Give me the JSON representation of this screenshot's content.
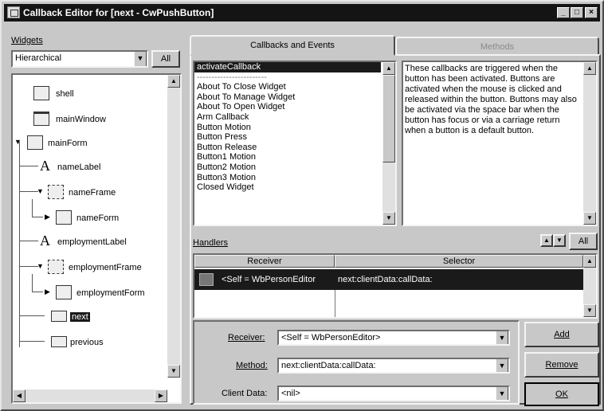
{
  "window": {
    "title": "Callback Editor for [next - CwPushButton]",
    "buttons": [
      "_",
      "□",
      "×"
    ]
  },
  "widgets_panel": {
    "label": "Widgets",
    "view_mode": "Hierarchical",
    "all_button": "All",
    "tree": [
      {
        "name": "shell",
        "icon": "shell-icon"
      },
      {
        "name": "mainWindow",
        "icon": "window-icon"
      },
      {
        "name": "mainForm",
        "icon": "form-icon"
      },
      {
        "name": "nameLabel",
        "icon": "label-icon"
      },
      {
        "name": "nameFrame",
        "icon": "frame-icon"
      },
      {
        "name": "nameForm",
        "icon": "form-icon"
      },
      {
        "name": "employmentLabel",
        "icon": "label-icon"
      },
      {
        "name": "employmentFrame",
        "icon": "frame-icon"
      },
      {
        "name": "employmentForm",
        "icon": "form-icon"
      },
      {
        "name": "next",
        "icon": "button-icon"
      },
      {
        "name": "previous",
        "icon": "button-icon"
      }
    ]
  },
  "tabs": [
    {
      "label": "Callbacks and Events",
      "active": true
    },
    {
      "label": "Methods",
      "active": false
    }
  ],
  "callbacks": {
    "selected": "activateCallback",
    "separator": "------------------------",
    "items": [
      "About To Close Widget",
      "About To Manage Widget",
      "About To Open Widget",
      "Arm Callback",
      "Button Motion",
      "Button Press",
      "Button Release",
      "Button1 Motion",
      "Button2 Motion",
      "Button3 Motion",
      "Closed Widget"
    ]
  },
  "description": "These callbacks are triggered when the button has been activated. Buttons are activated when the mouse is clicked and released within the button. Buttons may also be activated via the space bar when the button has focus or via a carriage return when a button is a default button.",
  "handlers": {
    "label": "Handlers",
    "all_button": "All",
    "columns": [
      "Receiver",
      "Selector"
    ],
    "rows": [
      {
        "receiver": "<Self = WbPersonEditor",
        "selector": "next:clientData:callData:"
      }
    ]
  },
  "form": {
    "receiver_label": "Receiver:",
    "receiver_value": "<Self = WbPersonEditor>",
    "method_label": "Method:",
    "method_value": "next:clientData:callData:",
    "client_data_label": "Client Data:",
    "client_data_value": "<nil>"
  },
  "buttons": {
    "add": "Add",
    "remove": "Remove",
    "ok": "OK"
  }
}
